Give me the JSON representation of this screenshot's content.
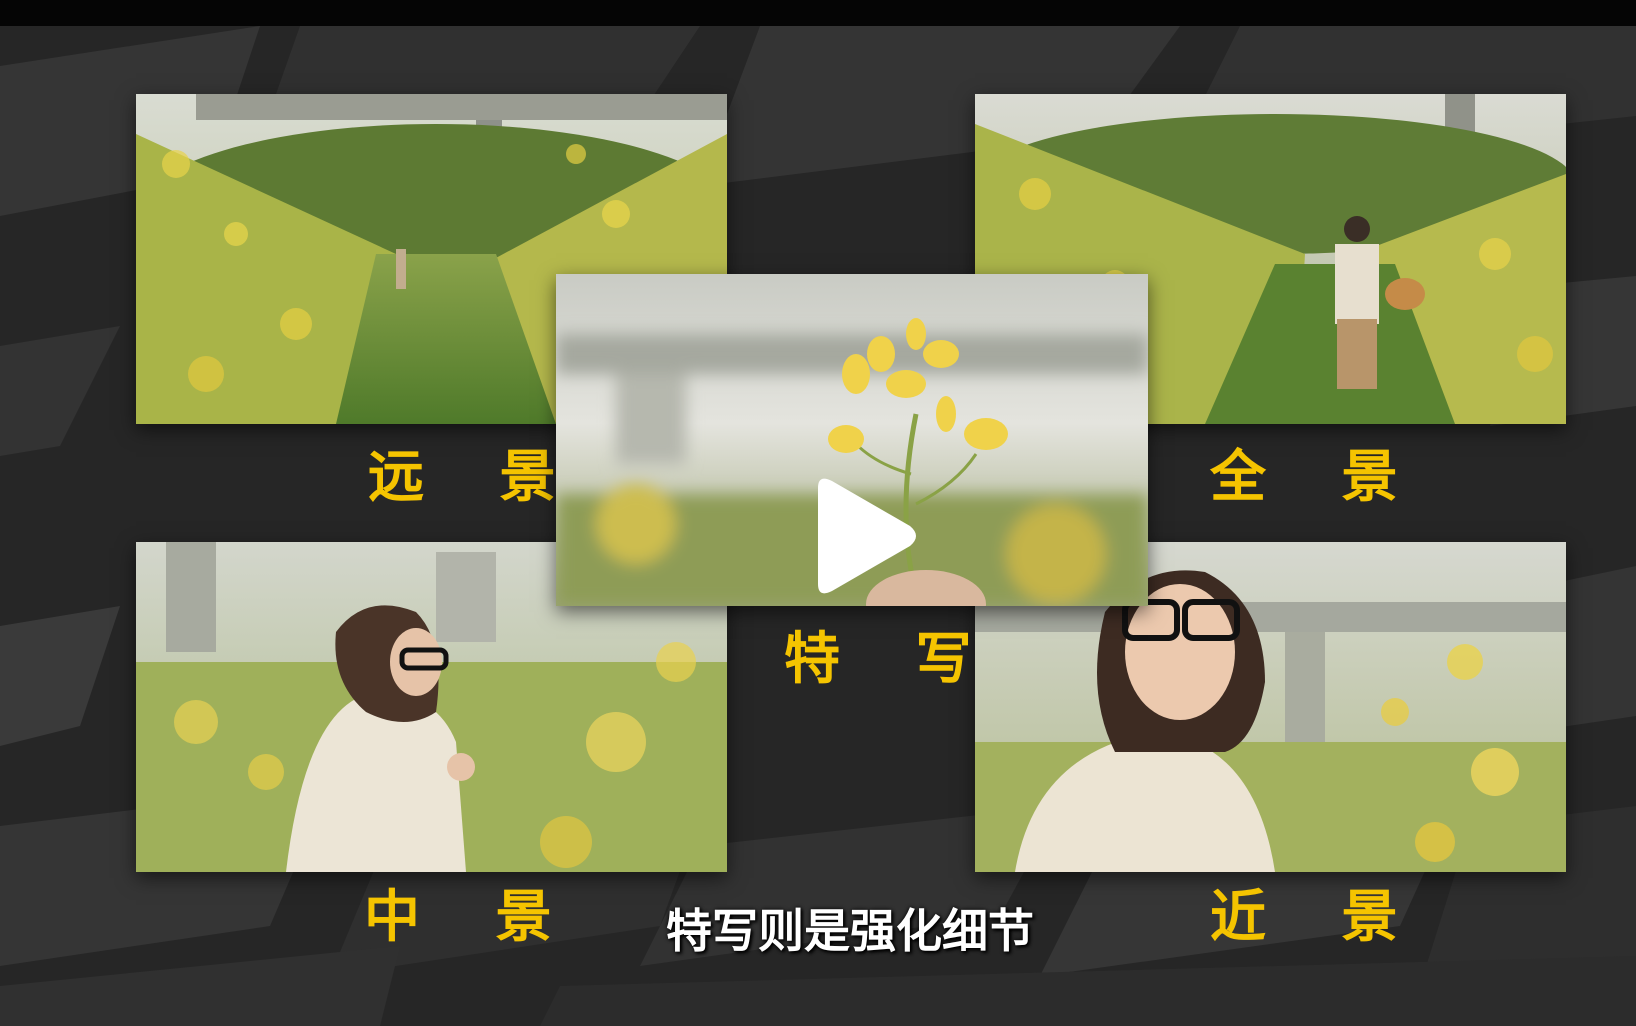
{
  "colors": {
    "label_yellow": "#f5c400",
    "subtitle_white": "#ffffff",
    "background_dark": "#222222",
    "stripe_gray": "#3a3a3a"
  },
  "shots": {
    "far": {
      "label": "远 景"
    },
    "full": {
      "label": "全 景"
    },
    "medium": {
      "label": "中 景"
    },
    "close": {
      "label": "近 景"
    },
    "closeup": {
      "label": "特 写"
    }
  },
  "player": {
    "icon": "play-icon"
  },
  "subtitle": "特写则是强化细节"
}
